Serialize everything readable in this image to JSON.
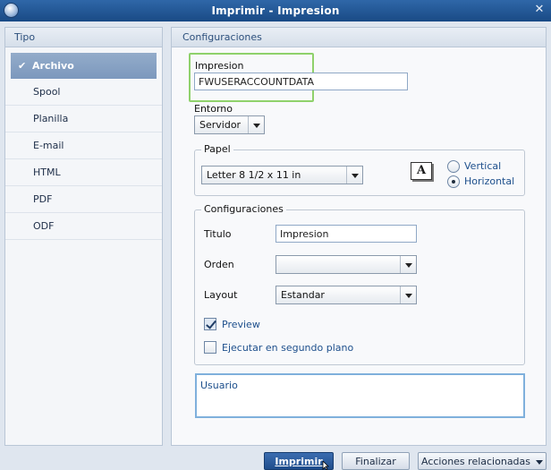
{
  "window": {
    "title": "Imprimir - Impresion",
    "close_glyph": "✕"
  },
  "left_panel": {
    "header": "Tipo",
    "items": [
      {
        "label": "Archivo",
        "selected": true
      },
      {
        "label": "Spool"
      },
      {
        "label": "Planilla"
      },
      {
        "label": "E-mail"
      },
      {
        "label": "HTML"
      },
      {
        "label": "PDF"
      },
      {
        "label": "ODF"
      }
    ]
  },
  "right_panel": {
    "header": "Configuraciones",
    "impresion": {
      "label": "Impresion",
      "value": "FWUSERACCOUNTDATA"
    },
    "entorno": {
      "label": "Entorno",
      "value": "Servidor"
    },
    "papel": {
      "legend": "Papel",
      "size_value": "Letter 8 1/2 x 11 in",
      "orientation_icon_letter": "A",
      "vertical_label": "Vertical",
      "horizontal_label": "Horizontal",
      "selected": "Horizontal"
    },
    "configuraciones": {
      "legend": "Configuraciones",
      "titulo_label": "Titulo",
      "titulo_value": "Impresion",
      "orden_label": "Orden",
      "orden_value": "",
      "layout_label": "Layout",
      "layout_value": "Estandar",
      "preview_label": "Preview",
      "preview_checked": true,
      "segundo_plano_label": "Ejecutar en segundo plano",
      "segundo_plano_checked": false
    },
    "usuario": {
      "placeholder": "Usuario"
    }
  },
  "footer": {
    "imprimir_label": "Imprimir",
    "finalizar_label": "Finalizar",
    "acciones_label": "Acciones relacionadas"
  },
  "colors": {
    "title_bar": "#194a85",
    "selected_item": "#7c98bd",
    "highlight_green": "#8fd16b",
    "primary_button": "#1f4d8c"
  }
}
